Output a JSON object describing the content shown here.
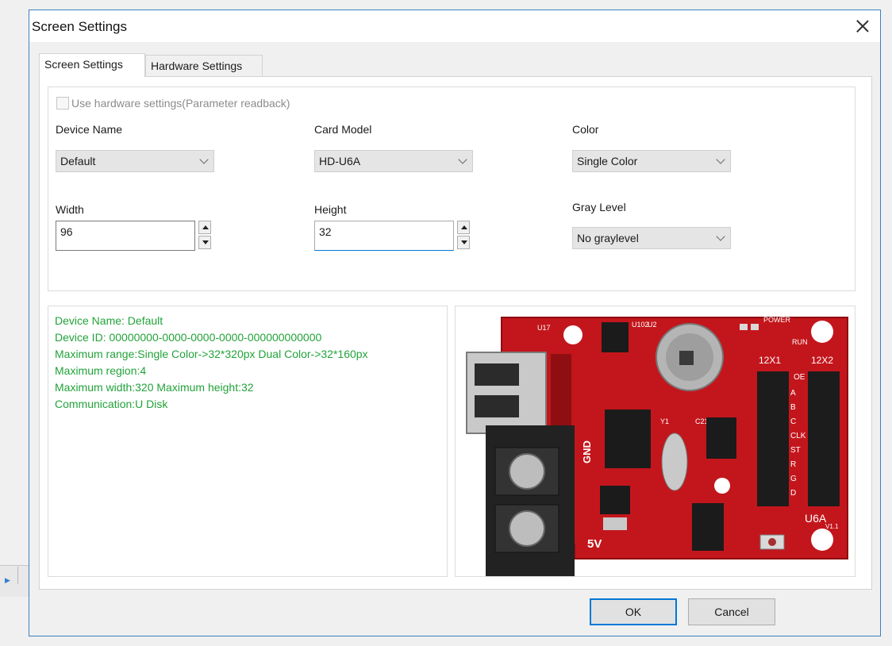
{
  "window": {
    "title": "Screen Settings"
  },
  "tabs": [
    {
      "label": "Screen Settings",
      "active": true
    },
    {
      "label": "Hardware Settings",
      "active": false
    }
  ],
  "form": {
    "use_hardware_label": "Use hardware settings(Parameter readback)",
    "use_hardware_checked": false,
    "device_name": {
      "label": "Device Name",
      "value": "Default"
    },
    "card_model": {
      "label": "Card Model",
      "value": "HD-U6A"
    },
    "color": {
      "label": "Color",
      "value": "Single Color"
    },
    "width": {
      "label": "Width",
      "value": "96"
    },
    "height": {
      "label": "Height",
      "value": "32"
    },
    "gray_level": {
      "label": "Gray Level",
      "value": "No graylevel"
    }
  },
  "info": [
    "Device Name: Default",
    "Device ID:  00000000-0000-0000-0000-000000000000",
    "Maximum range:Single Color->32*320px  Dual Color->32*160px",
    "Maximum region:4",
    "Maximum width:320 Maximum height:32",
    "Communication:U Disk"
  ],
  "board": {
    "labels": {
      "u17": "U17",
      "u102": "U102",
      "u2": "U2",
      "power": "POWER",
      "run": "RUN",
      "gnd": "GND",
      "v5": "5V",
      "y1": "Y1",
      "c21": "C21",
      "hub1": "12X1",
      "hub2": "12X2",
      "model": "U6A",
      "version": "V1.1",
      "pins": [
        "OE",
        "A",
        "B",
        "C",
        "CLK",
        "ST",
        "R",
        "G",
        "D"
      ]
    },
    "colors": {
      "pcb": "#c3161c",
      "pcb_dark": "#8e0e12",
      "metal": "#c9c9c9",
      "connector": "#222222"
    }
  },
  "buttons": {
    "ok": "OK",
    "cancel": "Cancel"
  },
  "colors": {
    "accent": "#0078d7",
    "info_text": "#22a33a",
    "window_border": "#3c7fc4"
  }
}
